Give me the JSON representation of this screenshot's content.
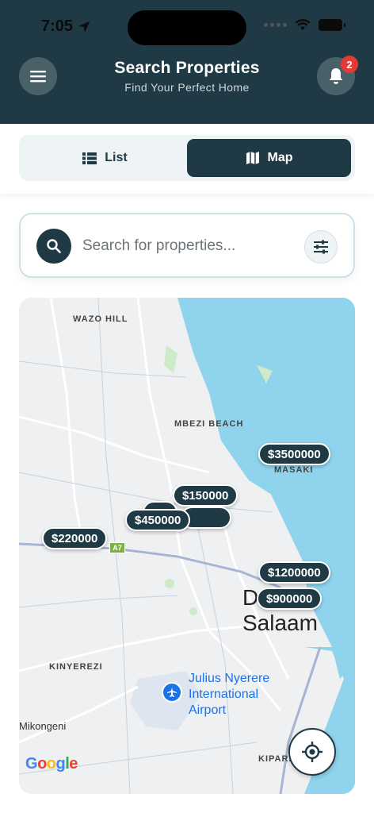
{
  "status_bar": {
    "time": "7:05"
  },
  "header": {
    "title": "Search Properties",
    "subtitle": "Find Your Perfect Home",
    "notification_count": "2",
    "menu_icon": "hamburger-menu-icon",
    "bell_icon": "bell-icon"
  },
  "view_toggle": {
    "list_label": "List",
    "map_label": "Map",
    "active": "Map"
  },
  "search": {
    "placeholder": "Search for properties...",
    "value": ""
  },
  "map": {
    "place_labels": {
      "wazo_hill": "WAZO HILL",
      "mbezi_beach": "MBEZI BEACH",
      "masaki": "MASAKI",
      "kinyerezi": "KINYEREZI",
      "mikongeni": "Mikongeni",
      "kipara": "KIPARA",
      "city": "Dar es Salaam",
      "airport": "Julius Nyerere International Airport",
      "road_shield": "A7"
    },
    "price_pins": [
      "$3500000",
      "$150000",
      "$450000",
      "$220000",
      "$1200000",
      "$900000"
    ],
    "attribution": "Google"
  },
  "colors": {
    "primary": "#1f3a44",
    "badge": "#e53935",
    "water": "#8fd3ec",
    "airport_blue": "#1a73e8"
  }
}
